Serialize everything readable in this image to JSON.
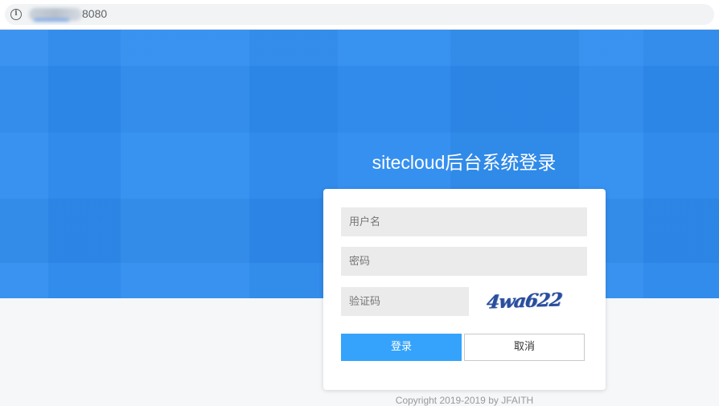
{
  "browser": {
    "url_visible_suffix": "8080",
    "info_icon": "info-icon"
  },
  "login": {
    "title": "sitecloud后台系统登录",
    "username_placeholder": "用户名",
    "password_placeholder": "密码",
    "captcha_placeholder": "验证码",
    "captcha_text": "4wa622",
    "login_label": "登录",
    "cancel_label": "取消"
  },
  "footer": {
    "copyright": "Copyright 2019-2019 by JFAITH"
  },
  "colors": {
    "banner": "#2e8cf0",
    "login_button": "#35a3fb",
    "input_background": "#ebebeb"
  }
}
